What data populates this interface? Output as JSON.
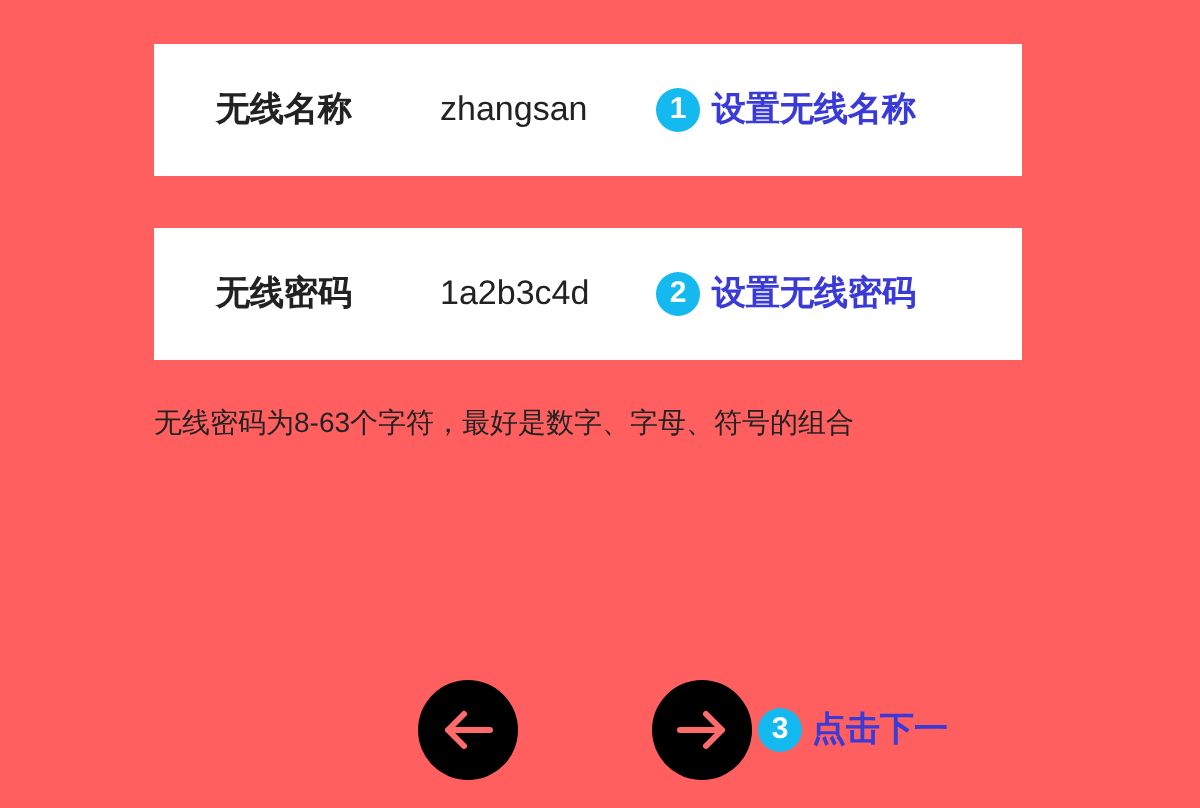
{
  "fields": [
    {
      "label": "无线名称",
      "value": "zhangsan",
      "step": "1",
      "note": "设置无线名称"
    },
    {
      "label": "无线密码",
      "value": "1a2b3c4d",
      "step": "2",
      "note": "设置无线密码"
    }
  ],
  "hint": "无线密码为8-63个字符，最好是数字、字母、符号的组合",
  "nav": [
    {
      "kind": "back"
    },
    {
      "kind": "next"
    }
  ],
  "next_annotation": {
    "step": "3",
    "note": "点击下一"
  }
}
